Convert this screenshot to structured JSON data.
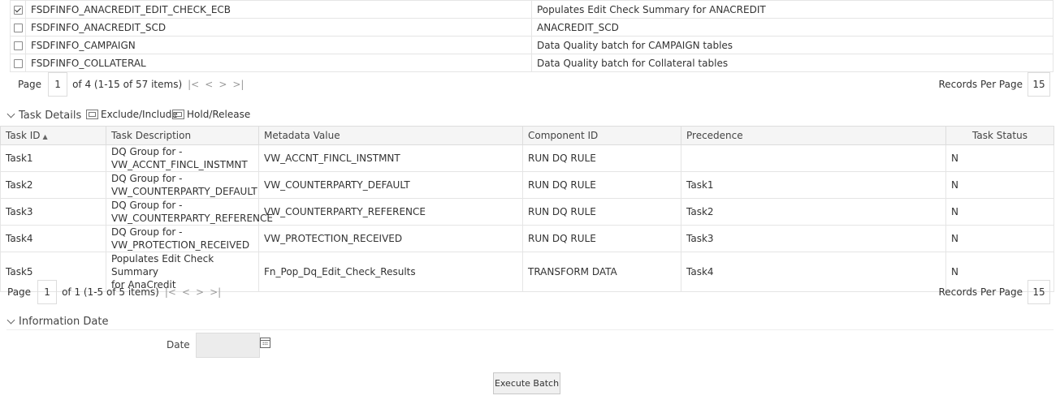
{
  "batches": [
    {
      "checked": true,
      "name": "FSDFINFO_ANACREDIT_EDIT_CHECK_ECB",
      "description": "Populates Edit Check Summary for ANACREDIT"
    },
    {
      "checked": false,
      "name": "FSDFINFO_ANACREDIT_SCD",
      "description": "ANACREDIT_SCD"
    },
    {
      "checked": false,
      "name": "FSDFINFO_CAMPAIGN",
      "description": "Data Quality batch for CAMPAIGN tables"
    },
    {
      "checked": false,
      "name": "FSDFINFO_COLLATERAL",
      "description": "Data Quality batch for Collateral tables"
    }
  ],
  "batch_pager": {
    "page_label": "Page",
    "page": "1",
    "summary": "of 4 (1-15 of 57 items)",
    "rpp_label": "Records Per Page",
    "rpp": "15"
  },
  "task_section": {
    "title": "Task Details",
    "exclude_label": "Exclude/Include",
    "hold_label": "Hold/Release"
  },
  "task_columns": [
    "Task ID",
    "Task Description",
    "Metadata Value",
    "Component ID",
    "Precedence",
    "Task Status"
  ],
  "sort_indicator": "▲",
  "tasks": [
    {
      "id": "Task1",
      "desc1": "DQ Group for -",
      "desc2": "VW_ACCNT_FINCL_INSTMNT",
      "meta": "VW_ACCNT_FINCL_INSTMNT",
      "component": "RUN DQ RULE",
      "precedence": "",
      "status": "N"
    },
    {
      "id": "Task2",
      "desc1": "DQ Group for -",
      "desc2": "VW_COUNTERPARTY_DEFAULT",
      "meta": "VW_COUNTERPARTY_DEFAULT",
      "component": "RUN DQ RULE",
      "precedence": "Task1",
      "status": "N"
    },
    {
      "id": "Task3",
      "desc1": "DQ Group for -",
      "desc2": "VW_COUNTERPARTY_REFERENCE",
      "meta": "VW_COUNTERPARTY_REFERENCE",
      "component": "RUN DQ RULE",
      "precedence": "Task2",
      "status": "N"
    },
    {
      "id": "Task4",
      "desc1": "DQ Group for -",
      "desc2": "VW_PROTECTION_RECEIVED",
      "meta": "VW_PROTECTION_RECEIVED",
      "component": "RUN DQ RULE",
      "precedence": "Task3",
      "status": "N"
    },
    {
      "id": "Task5",
      "desc1": "Populates Edit Check Summary",
      "desc2": "for AnaCredit",
      "meta": "Fn_Pop_Dq_Edit_Check_Results",
      "component": "TRANSFORM DATA",
      "precedence": "Task4",
      "status": "N"
    }
  ],
  "task_pager": {
    "page_label": "Page",
    "page": "1",
    "summary": "of 1 (1-5 of 5 items)",
    "rpp_label": "Records Per Page",
    "rpp": "15"
  },
  "info_section": {
    "title": "Information Date",
    "date_label": "Date",
    "date_value": ""
  },
  "execute_label": "Execute Batch"
}
